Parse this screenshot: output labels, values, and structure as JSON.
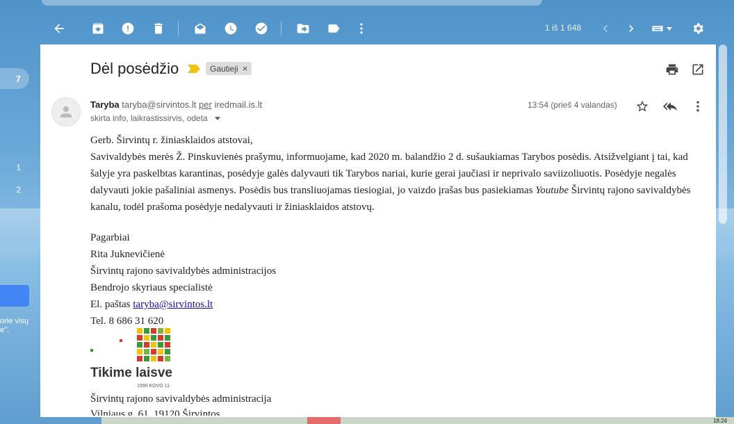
{
  "toolbar": {
    "icons": [
      "back-arrow-icon",
      "archive-icon",
      "report-spam-icon",
      "delete-icon",
      "mark-unread-icon",
      "snooze-icon",
      "add-to-tasks-icon",
      "move-to-icon",
      "label-icon",
      "more-vert-icon"
    ],
    "pager": "1 iš 1 648"
  },
  "left_rail": {
    "badge": "7",
    "nums": [
      "1",
      "2"
    ],
    "text_fragment_1": "orie visų",
    "text_fragment_2": "e\"."
  },
  "message": {
    "subject": "Dėl posėdžio",
    "label": "Gautieji",
    "sender_name": "Taryba",
    "sender_email": "taryba@sirvintos.lt",
    "via": "per",
    "via_domain": "iredmail.is.lt",
    "recipients": "skirta info, laikrastissirvis, odeta",
    "time": "13:54 (prieš 4 valandas)",
    "body": {
      "greeting": "Gerb. Širvintų r. žiniasklaidos atstovai,",
      "para_main": "Savivaldybės merės Ž. Pinskuvienės prašymu, informuojame, kad 2020 m. balandžio 2 d. sušaukiamas Tarybos posėdis. Atsižvelgiant į tai, kad šalyje yra paskelbtas karantinas, posėdyje galės dalyvauti tik Tarybos nariai, kurie gerai jaučiasi ir neprivalo saviizoliuotis. Posėdyje negalės dalyvauti jokie pašaliniai asmenys. Posėdis bus transliuojamas tiesiogiai, jo vaizdo įrašas bus pasiekiamas ",
      "para_italic": "Youtube",
      "para_end": " Širvintų rajono savivaldybės kanalu, todėl prašoma posėdyje nedalyvauti ir žiniasklaidos atstovų.",
      "sig_closing": "Pagarbiai",
      "sig_name": "Rita Juknevičienė",
      "sig_org": "Širvintų rajono savivaldybės administracijos",
      "sig_role": "Bendrojo skyriaus specialistė",
      "sig_email_prefix": "El. paštas ",
      "sig_email": "taryba@sirvintos.lt",
      "sig_phone": "Tel. 8 686 31 620",
      "logo_title": "Tikime laisve",
      "logo_sub": "1990 KOVO 11",
      "org_footer": "Širvintų rajono savivaldybės administracija",
      "org_footer_partial": "Vilniaus g. 61, 19120 Širvintos"
    }
  },
  "taskbar": {
    "time": "18:24"
  },
  "colors": {
    "accent": "#4285f4",
    "importance": "#f4c20d",
    "link": "#1a0dab"
  }
}
